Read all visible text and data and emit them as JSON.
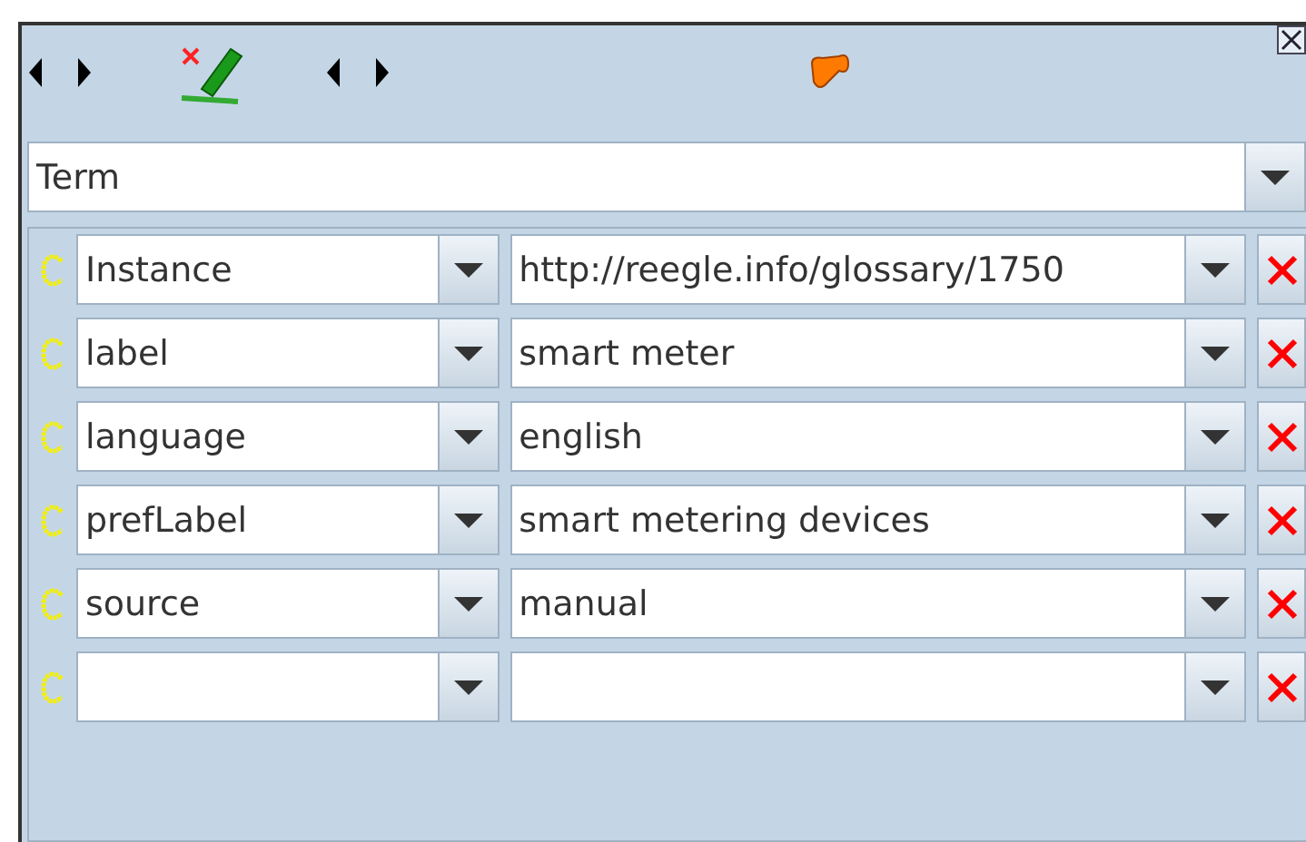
{
  "type_selector": {
    "value": "Term"
  },
  "properties": [
    {
      "kind": "entry",
      "property": "Instance",
      "value": "http://reegle.info/glossary/1750"
    },
    {
      "kind": "entry",
      "property": "label",
      "value": "smart meter"
    },
    {
      "kind": "entry",
      "property": "language",
      "value": "english"
    },
    {
      "kind": "entry",
      "property": "prefLabel",
      "value": "smart metering devices"
    },
    {
      "kind": "entry",
      "property": "source",
      "value": "manual"
    },
    {
      "kind": "blank"
    }
  ]
}
